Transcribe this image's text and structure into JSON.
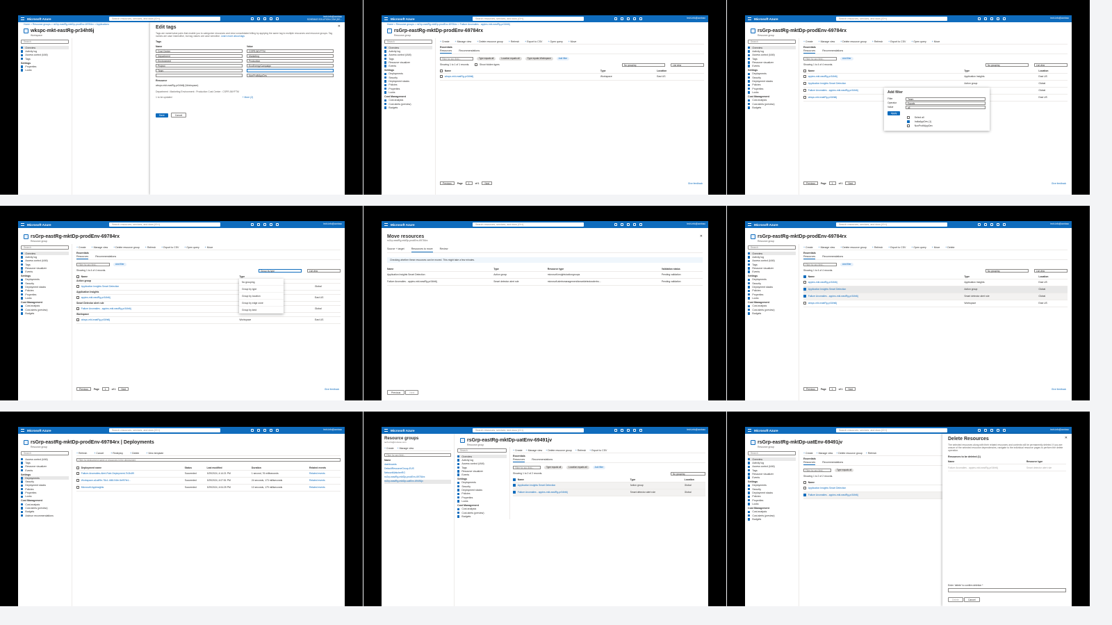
{
  "portal": {
    "brand": "Microsoft Azure",
    "search_placeholder": "Search resources, services, and docs (G+/)",
    "user": "tech-info@contoso",
    "user_domain": "SCHEMAS SOLUTION.COM (DE..."
  },
  "nav": {
    "overview": "Overview",
    "activity_log": "Activity log",
    "access_control": "Access control (IAM)",
    "tags": "Tags",
    "resource_visualizer": "Resource visualizer",
    "events": "Events",
    "settings": "Settings",
    "deployments": "Deployments",
    "security": "Security",
    "deployment_stacks": "Deployment stacks",
    "policies": "Policies",
    "properties": "Properties",
    "locks": "Locks",
    "cost_management": "Cost Management",
    "cost_analysis": "Cost analysis",
    "cost_alerts": "Cost alerts (preview)",
    "budgets": "Budgets",
    "advisor": "Advisor recommendations",
    "search": "Search"
  },
  "toolbar": {
    "create": "Create",
    "manage_view": "Manage view",
    "delete_rg": "Delete resource group",
    "refresh": "Refresh",
    "export_csv": "Export to CSV",
    "open_query": "Open query",
    "assign_tags": "Assign tags",
    "move": "Move",
    "delete": "Delete"
  },
  "common": {
    "essentials": "Essentials",
    "tab_resources": "Resources",
    "tab_recommendations": "Recommendations",
    "filter_placeholder": "Filter for any field...",
    "add_filter": "Add filter",
    "show_hidden": "Show hidden types",
    "no_grouping": "No grouping",
    "list_view": "List view",
    "col_name": "Name",
    "col_type": "Type",
    "col_location": "Location",
    "previous": "Previous",
    "next": "Next",
    "page": "Page",
    "of1": "of 1",
    "feedback": "Give feedback",
    "rg_sub": "Resource group",
    "type_equals_all": "Type equals all",
    "location_equals_all": "Location equals all",
    "type_equals_workspace": "Type equals Workspace"
  },
  "panel1": {
    "bc": "Home > Resource groups > rsGrp-eastRg-mktDp-prodEnv-69784rx > Applications",
    "title": "wkspc-mkt-eastRg-pr34ht6j",
    "sub": "Workspace",
    "dialog_title": "Edit tags",
    "dialog_desc": "Tags are name/value pairs that enable you to categorize resources and view consolidated billing by applying the same tag to multiple resources and resource groups. Tag names are case insensitive, but tag values are case sensitive.",
    "learn_more": "Learn more about tags",
    "tags_label": "Tags",
    "name_h": "Name",
    "value_h": "Value",
    "rows": [
      {
        "name": "Cost Center",
        "value": "CSPR-56YFTM"
      },
      {
        "name": "Department",
        "value": "Marketing"
      },
      {
        "name": "Environment",
        "value": "Production"
      },
      {
        "name": "Project",
        "value": "EcoEnergyCampaign"
      },
      {
        "name": "Team",
        "value": ""
      },
      {
        "name": "",
        "value": "NonProfitAppDev"
      }
    ],
    "resource_label": "Resource",
    "resource_name": "wkspc-mkt-eastRg-pr34ht6j (Workspace)",
    "resource_tags": "Department : Marketing   Environment : Production   Cost Center : CSPR-56YFTM",
    "to_update": "1 to be updated",
    "more": "+ More (2)",
    "save": "Save",
    "cancel": "Cancel"
  },
  "panel2": {
    "bc": "Home > Resource groups > rsGrp-eastRg-mktDp-prodEnv-69784rx > Failure Anomalies - appins-mkt-eastRg-pr34ht6j",
    "title": "rsGrp-eastRg-mktDp-prodEnv-69784rx",
    "count": "Showing 1 to 1 of 1 records.",
    "rows": [
      {
        "name": "wkspc-mkt-eastRg-pr34ht6j",
        "type": "Workspace",
        "location": "East US"
      }
    ]
  },
  "panel3": {
    "title": "rsGrp-eastRg-mktDp-prodEnv-69784rx",
    "count": "Showing 1 to 4 of 4 records.",
    "popup_title": "Add filter",
    "filter_l": "Filter",
    "filter_v": "Team",
    "operator_l": "Operator",
    "operator_v": "Equals",
    "value_l": "Value",
    "value_v": "all",
    "apply": "Apply",
    "opt1": "Select all",
    "opt2": "IndiaAppDev (1)",
    "opt3": "NonProfitAppDev",
    "rows": [
      {
        "name": "appins-mkt-eastRg-pr34ht6j",
        "type": "Application Insights",
        "location": "East US"
      },
      {
        "name": "Application Insights Smart Detection",
        "type": "Action group",
        "location": "Global"
      },
      {
        "name": "Failure Anomalies - appins-mkt-eastRg-pr34ht6j",
        "type": "Smart detector alert rule",
        "location": "Global"
      },
      {
        "name": "wkspc-mkt-eastRg-pr34ht6j",
        "type": "Workspace",
        "location": "East US"
      }
    ]
  },
  "panel4": {
    "title": "rsGrp-eastRg-mktDp-prodEnv-69784rx",
    "count": "Showing 1 to 4 of 4 records.",
    "grouping": "Group by type",
    "dd": [
      "No grouping",
      "Group by type",
      "Group by location",
      "Group by edge zone",
      "Group by kind"
    ],
    "groups": [
      {
        "g": "Action group",
        "name": "Application Insights Smart Detection",
        "type": "Action group",
        "location": "Global"
      },
      {
        "g": "Application Insights",
        "name": "appins-mkt-eastRg-pr34ht6j",
        "type": "Application Insights",
        "location": "East US"
      },
      {
        "g": "Smart Detector alert rule",
        "name": "Failure Anomalies - appins-mkt-eastRg-pr34ht6j",
        "type": "Smart detector alert rule",
        "location": "Global"
      },
      {
        "g": "Workspace",
        "name": "wkspc-mkt-eastRg-pr34ht6j",
        "type": "Workspace",
        "location": "East US"
      }
    ]
  },
  "panel5": {
    "title": "Move resources",
    "sub": "rsGrp-eastRg-mktDp-prodEnv-69784rx",
    "steps": [
      "Source + target",
      "Resources to move",
      "Review"
    ],
    "info": "Checking whether these resources can be moved. This might take a few minutes.",
    "h_name": "Name",
    "h_type": "Type",
    "h_rtype": "Resource type",
    "h_status": "Validation status",
    "rows": [
      {
        "name": "Application Insights Smart Detection",
        "type": "Action group",
        "rtype": "microsoft.insights/actiongroups",
        "status": "Pending validation"
      },
      {
        "name": "Failure Anomalies - appins-mkt-eastRg-pr34ht6j",
        "type": "Smart detector alert rule",
        "rtype": "microsoft.alertsmanagement/smartdetectoralertru...",
        "status": "Pending validation"
      }
    ],
    "previous": "Previous",
    "next": "Next"
  },
  "panel6": {
    "title": "rsGrp-eastRg-mktDp-prodEnv-69784rx",
    "count": "Showing 1 to 4 of 4 records."
  },
  "panel7": {
    "title": "rsGrp-eastRg-mktDp-prodEnv-69784rx | Deployments",
    "filter": "Filter by deployment name or resources in the deployment",
    "tb": [
      "Refresh",
      "Cancel",
      "Redeploy",
      "Delete",
      "View template"
    ],
    "h": [
      "Deployment name",
      "Status",
      "Last modified",
      "Duration",
      "Related events"
    ],
    "rows": [
      {
        "n": "Failure-Anomalies-Alert-Rule-Deployment-7b2b4f9",
        "s": "Succeeded",
        "m": "3/29/2024, 4:14:21 PM",
        "d": "1 second, 76 milliseconds",
        "e": "Related events"
      },
      {
        "n": "Workspace-a1a4f9e-78c1-4f48-94fe-5ef97fe1...",
        "s": "Succeeded",
        "m": "3/29/2024, 4:07:51 PM",
        "d": "24 seconds, 173 milliseconds",
        "e": "Related events"
      },
      {
        "n": "Microsoft.AppInsights",
        "s": "Succeeded",
        "m": "3/29/2024, 4:04:25 PM",
        "d": "10 seconds, 179 milliseconds",
        "e": "Related events"
      }
    ]
  },
  "panel8": {
    "list_title": "Resource groups",
    "list_sub": "tech-info@contoso.com",
    "rgs": [
      "dashboards",
      "DefaultResourceGroup-EUS",
      "NetworkWatcherRG",
      "rsGrp-eastRg-mktDp-prodEnv-69784rx",
      "rsGrp-eastRg-mktDp-uatEnv-69491jv"
    ],
    "title": "rsGrp-eastRg-mktDp-uatEnv-69491jv",
    "count": "Showing 1 to 2 of 2 records.",
    "rows": [
      {
        "name": "Application Insights Smart Detection",
        "type": "Action group",
        "location": "Global"
      },
      {
        "name": "Failure Anomalies - appins-mkt-eastRg-pr34ht6j",
        "type": "Smart detector alert rule",
        "location": "Global"
      }
    ]
  },
  "panel9": {
    "title": "rsGrp-eastRg-mktDp-uatEnv-69491jv",
    "dialog_title": "Delete Resources",
    "desc": "The selected resources along with their related resources and contents will be permanently deleted. If you are unsure of the selected resource dependencies, navigate to the individual resource pages to perform the delete operation.",
    "to_delete": "Resources to be deleted (1)",
    "h_name": "Name",
    "h_rtype": "Resource type",
    "confirm": "Enter 'delete' to confirm deletion *",
    "delete": "Delete",
    "cancel": "Cancel"
  }
}
